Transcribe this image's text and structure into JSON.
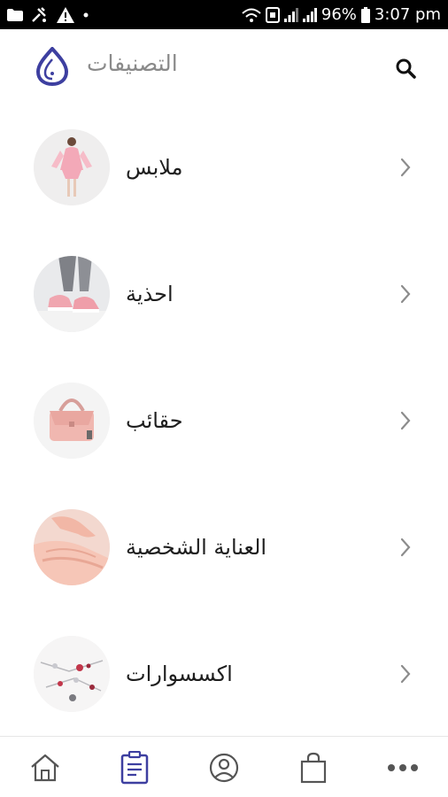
{
  "status_bar": {
    "battery": "96%",
    "time": "3:07 pm",
    "left_icons": [
      "folder-icon",
      "tools-icon",
      "warning-icon",
      "dot-icon"
    ],
    "right_icons": [
      "wifi-call-icon",
      "sim-icon",
      "signal-icon",
      "signal-icon",
      "battery-icon"
    ]
  },
  "header": {
    "title": "التصنيفات",
    "logo_icon": "brand-logo-icon",
    "search_icon": "search-icon",
    "accent_color": "#3d3fa0"
  },
  "categories": [
    {
      "label": "ملابس",
      "image": "clothing-image",
      "chevron": "chevron-right-icon"
    },
    {
      "label": "احذية",
      "image": "shoes-image",
      "chevron": "chevron-right-icon"
    },
    {
      "label": "حقائب",
      "image": "bags-image",
      "chevron": "chevron-right-icon"
    },
    {
      "label": "العناية الشخصية",
      "image": "personal-care-image",
      "chevron": "chevron-right-icon"
    },
    {
      "label": "اكسسوارات",
      "image": "accessories-image",
      "chevron": "chevron-right-icon"
    }
  ],
  "bottom_nav": {
    "items": [
      "home-icon",
      "categories-icon",
      "account-icon",
      "cart-icon",
      "more-icon"
    ],
    "active": "categories-icon",
    "active_color": "#3d3fa0",
    "inactive_color": "#555555"
  }
}
